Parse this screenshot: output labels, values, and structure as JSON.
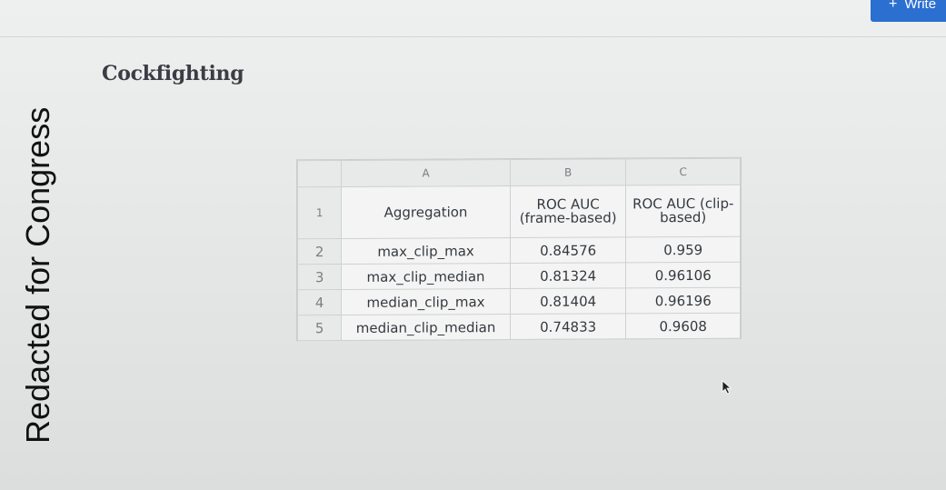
{
  "header": {
    "write_button": "Write",
    "plus_glyph": "+"
  },
  "redaction": "Redacted for Congress",
  "page": {
    "title": "Cockfighting"
  },
  "sheet": {
    "columns": [
      "A",
      "B",
      "C"
    ],
    "rows": [
      {
        "num": "1",
        "a": "Aggregation",
        "b": "ROC AUC (frame-based)",
        "c": "ROC AUC (clip-based)"
      },
      {
        "num": "2",
        "a": "max_clip_max",
        "b": "0.84576",
        "c": "0.959"
      },
      {
        "num": "3",
        "a": "max_clip_median",
        "b": "0.81324",
        "c": "0.96106"
      },
      {
        "num": "4",
        "a": "median_clip_max",
        "b": "0.81404",
        "c": "0.96196"
      },
      {
        "num": "5",
        "a": "median_clip_median",
        "b": "0.74833",
        "c": "0.9608"
      }
    ]
  },
  "colors": {
    "button": "#2b6fd0",
    "title": "#3a3d44",
    "cell_text": "#35393f",
    "header_text": "#7a7e84"
  },
  "icons": {
    "cursor": "mouse-pointer-icon",
    "plus": "plus-icon"
  }
}
